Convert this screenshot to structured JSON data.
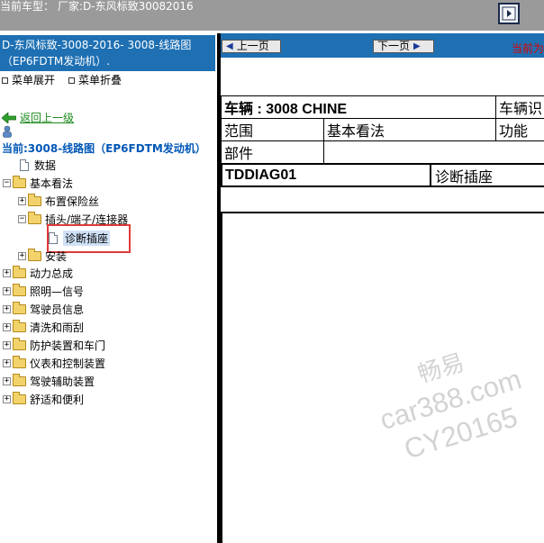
{
  "topbar": {
    "car_label": "当前车型：",
    "car_value": "厂家:D-东风标致30082016",
    "nav_icon": "toggle-panel-icon"
  },
  "sidebar": {
    "model_title": "D-东风标致-3008-2016- 3008-线路图（EP6FDTM发动机）.",
    "expand_all": "菜单展开",
    "collapse_all": "菜单折叠",
    "back_link": "返回上一级",
    "current": "当前:3008-线路图（EP6FDTM发动机）",
    "tree": [
      {
        "label": "数据",
        "type": "doc",
        "level": 1
      },
      {
        "label": "基本看法",
        "type": "folder",
        "expanded": true,
        "level": 0
      },
      {
        "label": "布置保险丝",
        "type": "folder",
        "expanded": false,
        "level": 1
      },
      {
        "label": "插头/端子/连接器",
        "type": "folder",
        "expanded": true,
        "level": 1
      },
      {
        "label": "诊断插座",
        "type": "doc",
        "selected": true,
        "level": 2
      },
      {
        "label": "安装",
        "type": "folder",
        "expanded": false,
        "level": 1
      },
      {
        "label": "动力总成",
        "type": "folder",
        "expanded": false,
        "level": 0
      },
      {
        "label": "照明—信号",
        "type": "folder",
        "expanded": false,
        "level": 0
      },
      {
        "label": "驾驶员信息",
        "type": "folder",
        "expanded": false,
        "level": 0
      },
      {
        "label": " 清洗和雨刮",
        "type": "folder",
        "expanded": false,
        "level": 0
      },
      {
        "label": "防护装置和车门",
        "type": "folder",
        "expanded": false,
        "level": 0
      },
      {
        "label": "仪表和控制装置",
        "type": "folder",
        "expanded": false,
        "level": 0
      },
      {
        "label": "驾驶辅助装置",
        "type": "folder",
        "expanded": false,
        "level": 0
      },
      {
        "label": "舒适和便利",
        "type": "folder",
        "expanded": false,
        "level": 0
      }
    ]
  },
  "main": {
    "prev_page": "上一页",
    "next_page": "下一页",
    "current_label": "当前为",
    "info": {
      "vehicle_label": "车辆 : 3008 CHINE",
      "vehicle_id_label": "车辆识",
      "scope_label": "范围",
      "scope_value": "基本看法",
      "function_label": "功能",
      "part_label": "部件"
    },
    "diag": {
      "code": "TDDIAG01",
      "name": "诊断插座"
    }
  },
  "watermark": {
    "line1": "畅易",
    "line2": "car388.com",
    "line3": "CY20165"
  },
  "colors": {
    "topbar_bg": "#9a9a9a",
    "accent_blue": "#1e70b3",
    "highlight_red": "#e03a3a",
    "link_green": "#1c8a1c"
  }
}
